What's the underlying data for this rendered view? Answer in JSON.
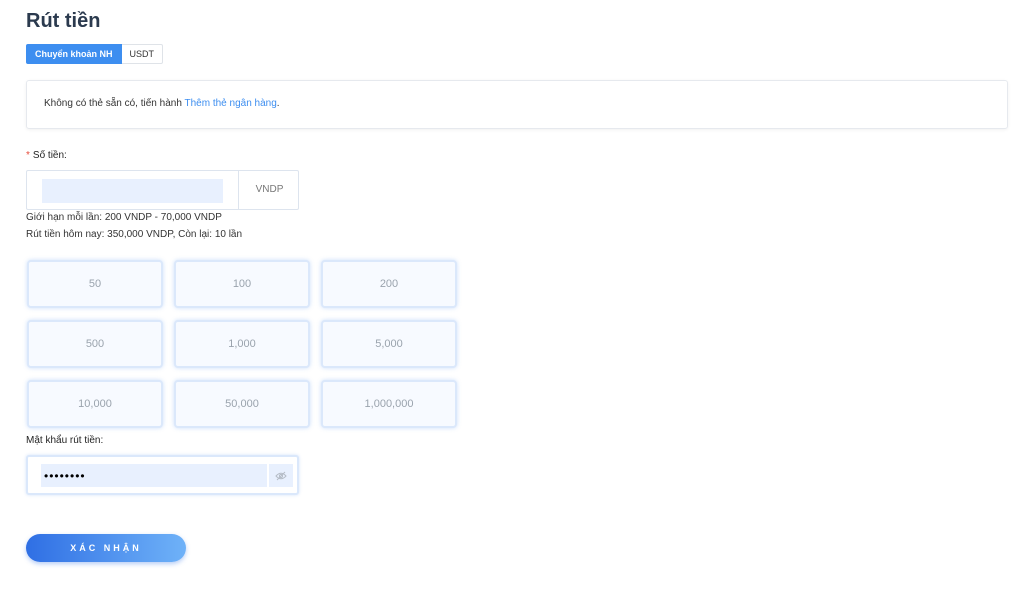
{
  "page": {
    "title": "Rút tiền"
  },
  "tabs": [
    {
      "label": "Chuyển khoản NH",
      "active": true
    },
    {
      "label": "USDT",
      "active": false
    }
  ],
  "notice": {
    "text": "Không có thẻ sẵn có, tiến hành ",
    "link": "Thêm thẻ ngân hàng",
    "suffix": "."
  },
  "amount": {
    "required_mark": "*",
    "label": "Số tiền:",
    "value": "",
    "unit": "VNDP",
    "limit_text": "Giới hạn mỗi lần: 200 VNDP - 70,000 VNDP",
    "today_text": "Rút tiền hôm nay: 350,000 VNDP, Còn lại: 10 lần"
  },
  "quick_amounts": [
    "50",
    "100",
    "200",
    "500",
    "1,000",
    "5,000",
    "10,000",
    "50,000",
    "1,000,000"
  ],
  "password": {
    "label": "Mật khẩu rút tiền:",
    "value": "••••••••",
    "eye_icon": "eye-off-icon"
  },
  "submit": {
    "label": "XÁC NHẬN"
  },
  "colors": {
    "accent": "#3d8ef0",
    "required": "#e74c3c",
    "input_fill": "#e8f0fe"
  }
}
